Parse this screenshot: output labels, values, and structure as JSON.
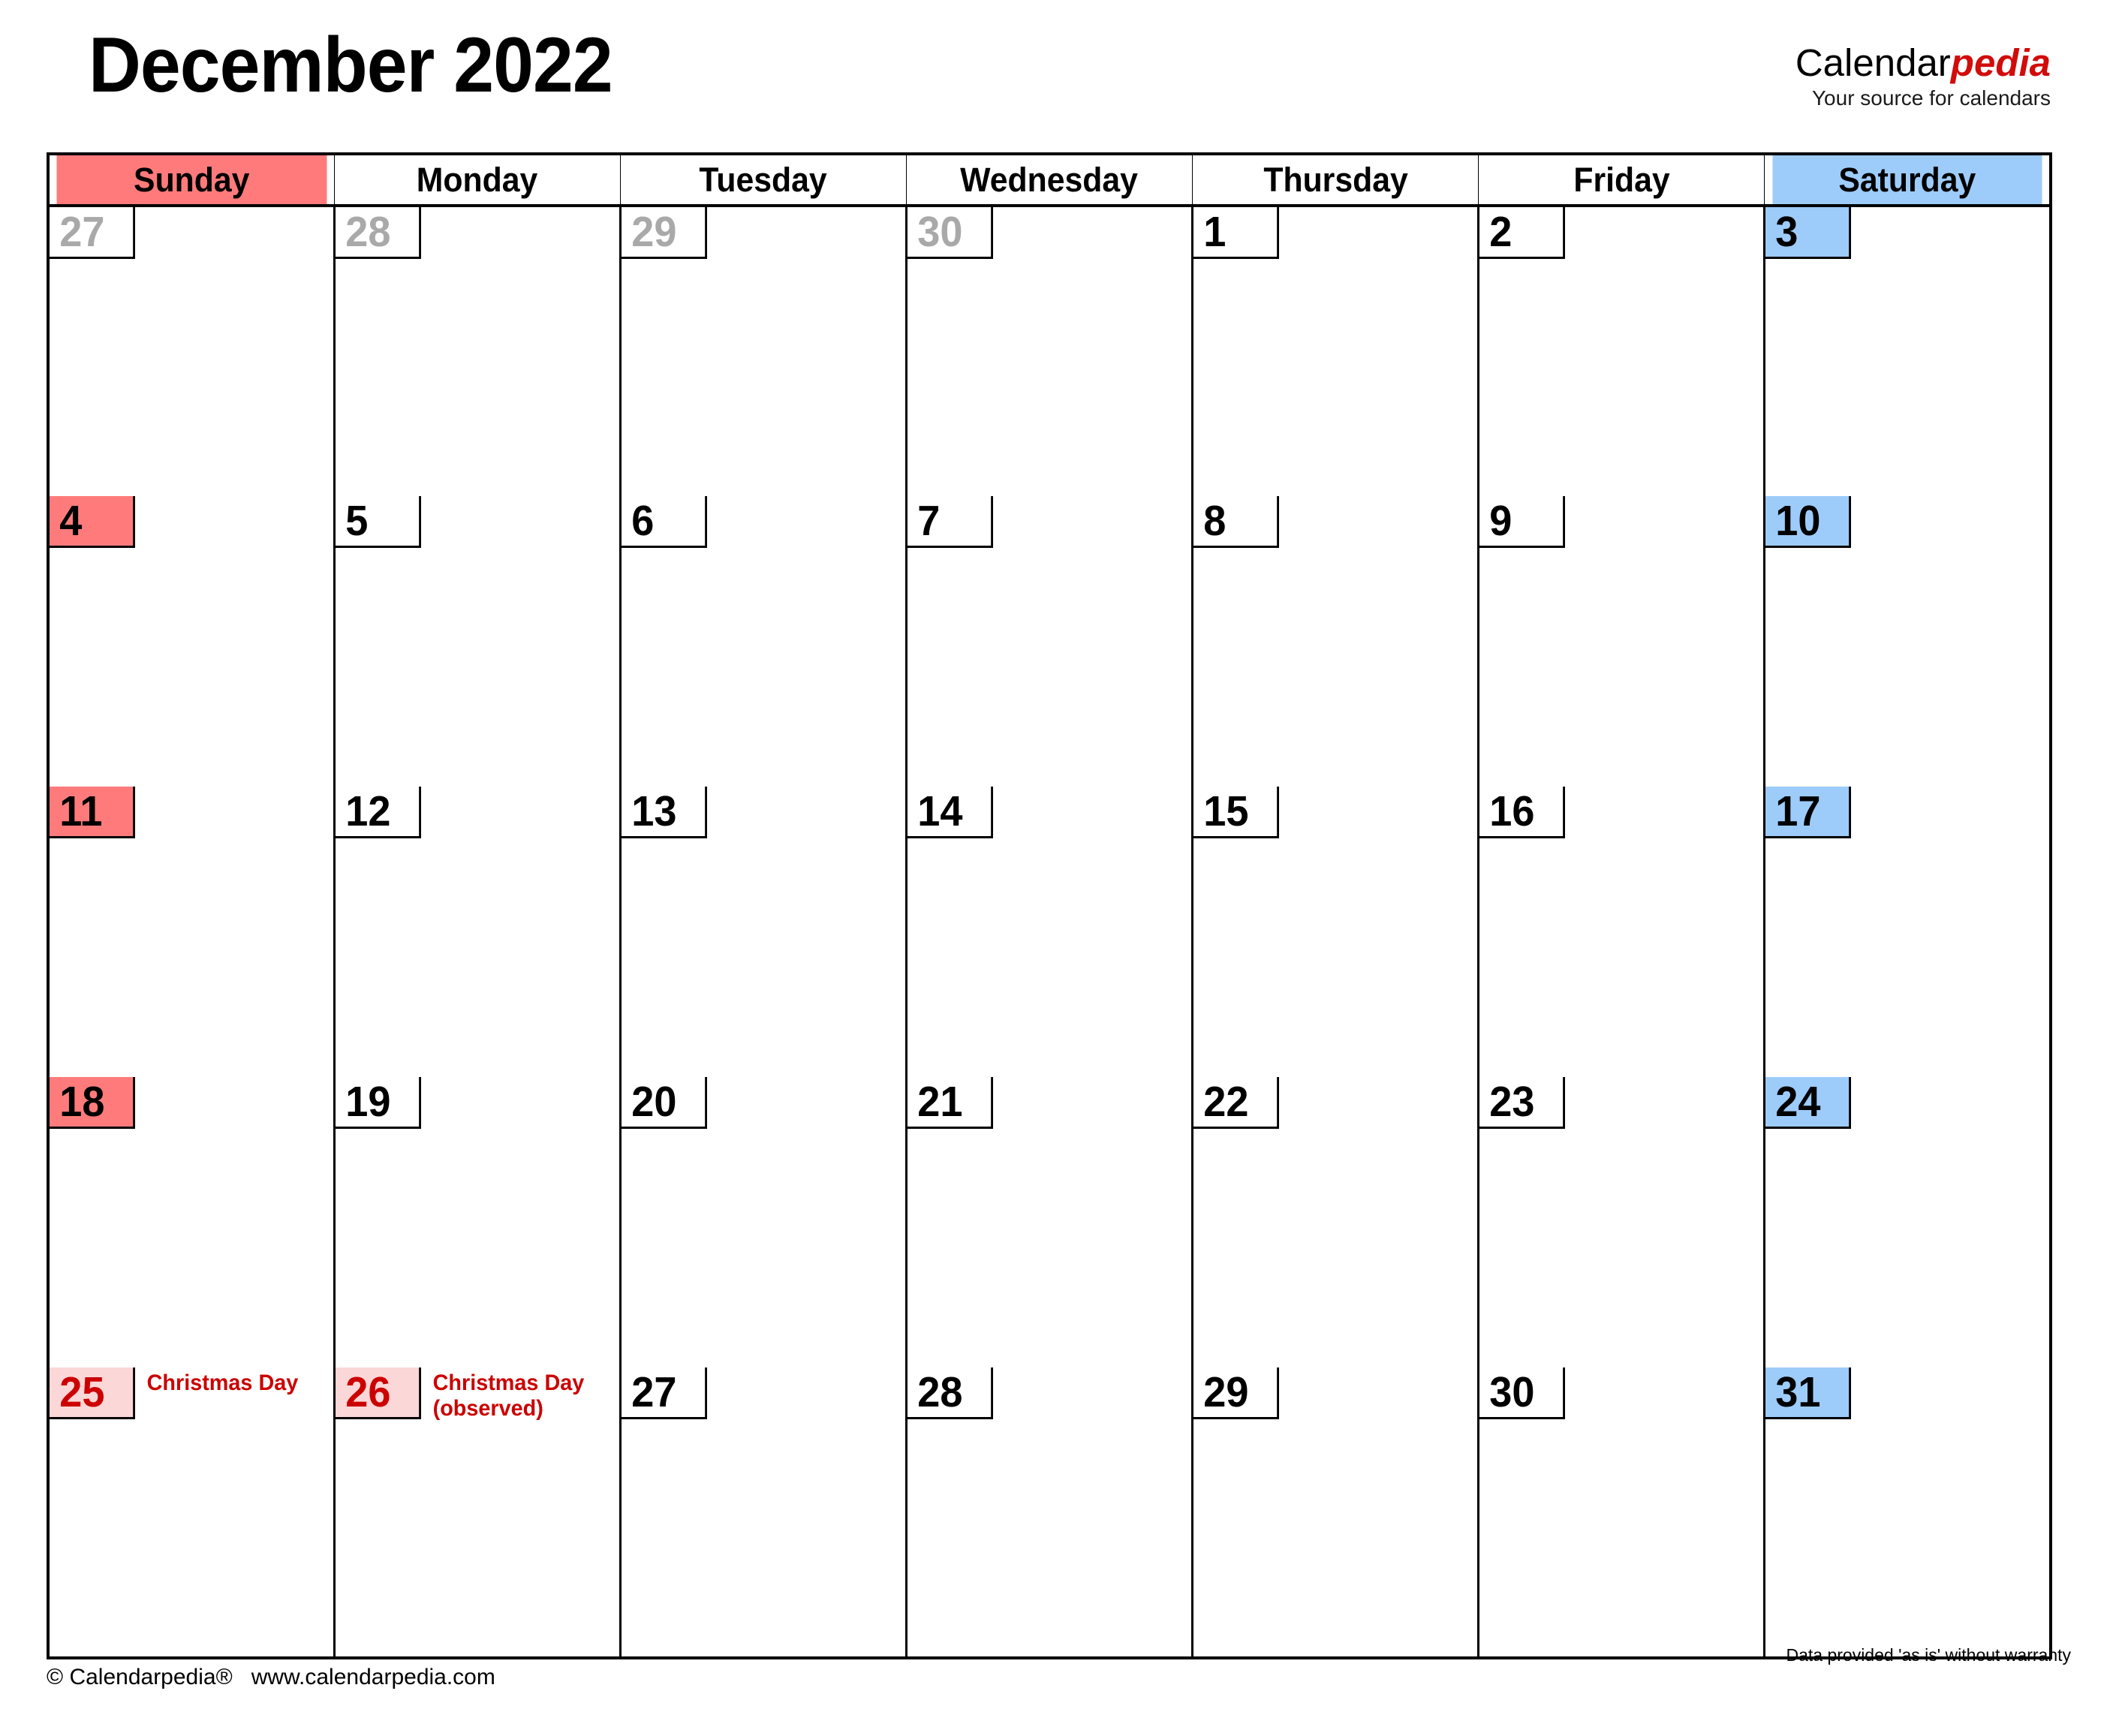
{
  "header": {
    "title": "December 2022",
    "brand": {
      "name_part1": "Calendar",
      "name_part2": "pedia",
      "tagline": "Your source for calendars"
    }
  },
  "colors": {
    "sunday_accent": "#FF7B7B",
    "saturday_accent": "#9DCCFB",
    "holiday_bg": "#FBD7D7",
    "holiday_text": "#CC0000",
    "other_month_text": "#A9A9A9",
    "brand_red": "#D20B0B",
    "grid_line": "#000000"
  },
  "weekdays": [
    {
      "label": "Sunday",
      "style": "sunday"
    },
    {
      "label": "Monday",
      "style": "weekday"
    },
    {
      "label": "Tuesday",
      "style": "weekday"
    },
    {
      "label": "Wednesday",
      "style": "weekday"
    },
    {
      "label": "Thursday",
      "style": "weekday"
    },
    {
      "label": "Friday",
      "style": "weekday"
    },
    {
      "label": "Saturday",
      "style": "saturday"
    }
  ],
  "weeks": [
    [
      {
        "day": "27",
        "type": "other",
        "holiday": ""
      },
      {
        "day": "28",
        "type": "other",
        "holiday": ""
      },
      {
        "day": "29",
        "type": "other",
        "holiday": ""
      },
      {
        "day": "30",
        "type": "other",
        "holiday": ""
      },
      {
        "day": "1",
        "type": "weekday",
        "holiday": ""
      },
      {
        "day": "2",
        "type": "weekday",
        "holiday": ""
      },
      {
        "day": "3",
        "type": "sat",
        "holiday": ""
      }
    ],
    [
      {
        "day": "4",
        "type": "sun",
        "holiday": ""
      },
      {
        "day": "5",
        "type": "weekday",
        "holiday": ""
      },
      {
        "day": "6",
        "type": "weekday",
        "holiday": ""
      },
      {
        "day": "7",
        "type": "weekday",
        "holiday": ""
      },
      {
        "day": "8",
        "type": "weekday",
        "holiday": ""
      },
      {
        "day": "9",
        "type": "weekday",
        "holiday": ""
      },
      {
        "day": "10",
        "type": "sat",
        "holiday": ""
      }
    ],
    [
      {
        "day": "11",
        "type": "sun",
        "holiday": ""
      },
      {
        "day": "12",
        "type": "weekday",
        "holiday": ""
      },
      {
        "day": "13",
        "type": "weekday",
        "holiday": ""
      },
      {
        "day": "14",
        "type": "weekday",
        "holiday": ""
      },
      {
        "day": "15",
        "type": "weekday",
        "holiday": ""
      },
      {
        "day": "16",
        "type": "weekday",
        "holiday": ""
      },
      {
        "day": "17",
        "type": "sat",
        "holiday": ""
      }
    ],
    [
      {
        "day": "18",
        "type": "sun",
        "holiday": ""
      },
      {
        "day": "19",
        "type": "weekday",
        "holiday": ""
      },
      {
        "day": "20",
        "type": "weekday",
        "holiday": ""
      },
      {
        "day": "21",
        "type": "weekday",
        "holiday": ""
      },
      {
        "day": "22",
        "type": "weekday",
        "holiday": ""
      },
      {
        "day": "23",
        "type": "weekday",
        "holiday": ""
      },
      {
        "day": "24",
        "type": "sat",
        "holiday": ""
      }
    ],
    [
      {
        "day": "25",
        "type": "holiday",
        "holiday": "Christmas Day"
      },
      {
        "day": "26",
        "type": "holiday",
        "holiday": "Christmas Day\n(observed)"
      },
      {
        "day": "27",
        "type": "weekday",
        "holiday": ""
      },
      {
        "day": "28",
        "type": "weekday",
        "holiday": ""
      },
      {
        "day": "29",
        "type": "weekday",
        "holiday": ""
      },
      {
        "day": "30",
        "type": "weekday",
        "holiday": ""
      },
      {
        "day": "31",
        "type": "sat",
        "holiday": ""
      }
    ]
  ],
  "footer": {
    "copyright": "© Calendarpedia®   www.calendarpedia.com",
    "disclaimer": "Data provided 'as is' without warranty"
  }
}
